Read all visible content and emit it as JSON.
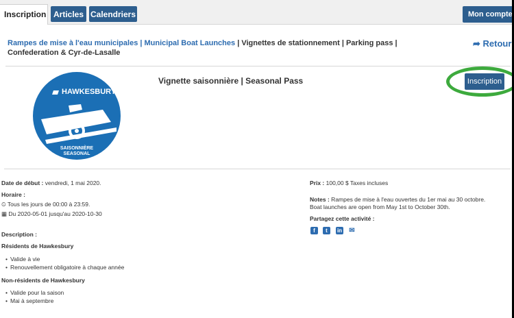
{
  "nav": {
    "tabs": [
      {
        "label": "Inscription"
      },
      {
        "label": "Articles"
      },
      {
        "label": "Calendriers"
      }
    ],
    "account_label": "Mon compte"
  },
  "breadcrumb": {
    "link": "Rampes de mise à l'eau municipales | Municipal Boat Launches",
    "sep": " | ",
    "rest": "Vignettes de stationnement | Parking pass | Confederation & Cyr-de-Lasalle",
    "back_label": "Retour"
  },
  "logo": {
    "brand": "HAWKESBURY",
    "line1": "SAISONNIÈRE",
    "line2": "SEASONAL"
  },
  "product": {
    "title": "Vignette saisonnière | Seasonal Pass",
    "register_label": "Inscription"
  },
  "details": {
    "start_label": "Date de début :",
    "start_value": " vendredi, 1 mai 2020.",
    "schedule_label": "Horaire :",
    "schedule_time": "Tous les jours de 00:00 à 23:59.",
    "schedule_dates": "Du 2020-05-01 jusqu'au 2020-10-30",
    "description_label": "Description :",
    "residents_title": "Résidents de Hawkesbury",
    "residents_items": [
      "Valide à vie",
      "Renouvellement obligatoire à chaque année"
    ],
    "nonresidents_title": "Non-résidents de Hawkesbury",
    "nonresidents_items": [
      "Valide pour la saison",
      "Mai à septembre"
    ]
  },
  "side": {
    "price_label": "Prix :",
    "price_value": " 100,00 $ Taxes incluses",
    "notes_label": "Notes :",
    "notes_line1": " Rampes de mise à l'eau ouvertes du 1er mai au 30 octobre.",
    "notes_line2": "Boat launches are open from May 1st to October 30th.",
    "share_label": "Partagez cette activité :",
    "share_icons": [
      "facebook-icon",
      "twitter-icon",
      "linkedin-icon",
      "email-icon"
    ]
  },
  "colors": {
    "primary": "#2d5e8e",
    "link": "#2d6cb0",
    "highlight": "#3daa3d",
    "logo_blue": "#1b6fb5"
  }
}
